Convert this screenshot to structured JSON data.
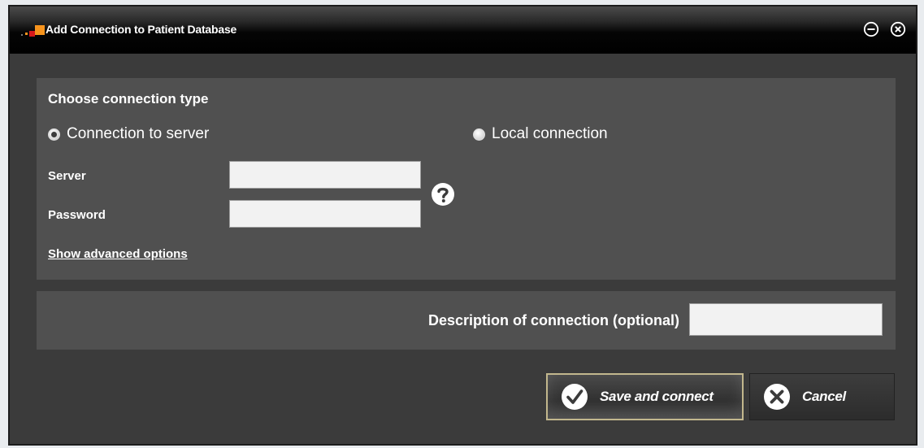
{
  "window": {
    "title": "Add Connection to Patient Database",
    "minimize_icon": "minus-circle-icon",
    "close_icon": "x-circle-icon"
  },
  "connection": {
    "section_title": "Choose connection type",
    "options": [
      {
        "label": "Connection to server",
        "selected": true
      },
      {
        "label": "Local connection",
        "selected": false
      }
    ],
    "server_label": "Server",
    "server_value": "",
    "password_label": "Password",
    "password_value": "",
    "help_icon": "question-mark-icon",
    "advanced_link": "Show advanced options"
  },
  "description": {
    "label": "Description of connection (optional)",
    "value": ""
  },
  "buttons": {
    "save_label": "Save and connect",
    "save_icon": "checkmark-icon",
    "cancel_label": "Cancel",
    "cancel_icon": "x-icon"
  },
  "colors": {
    "window_bg": "#3b3b3b",
    "panel_bg": "#505050",
    "save_border": "#c2b78d",
    "logo_orange": "#f7941d",
    "logo_red": "#d7191c"
  }
}
